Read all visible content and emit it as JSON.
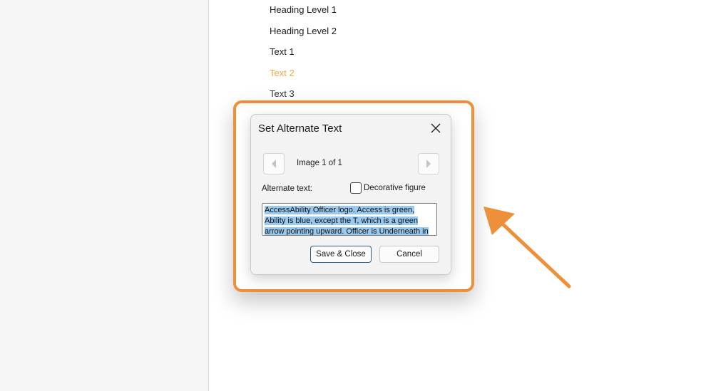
{
  "styles_list": {
    "items": [
      {
        "label": "Heading Level 1"
      },
      {
        "label": "Heading Level 2"
      },
      {
        "label": "Text 1"
      },
      {
        "label": "Text 2"
      },
      {
        "label": "Text 3"
      }
    ]
  },
  "dialog": {
    "title": "Set Alternate Text",
    "close_icon": "close-icon",
    "image_counter": "Image 1 of 1",
    "alt_label": "Alternate text:",
    "decorative_label": "Decorative figure",
    "decorative_checked": false,
    "alt_text": "AccessAbility Officer logo. Access is green, Ability is blue, except the T, which is a green arrow pointing upward. Officer is Underneath in black.",
    "save_label": "Save & Close",
    "cancel_label": "Cancel"
  },
  "annotation": {
    "frame_color": "#ee8f3a",
    "arrow_color": "#ee8f3a"
  }
}
